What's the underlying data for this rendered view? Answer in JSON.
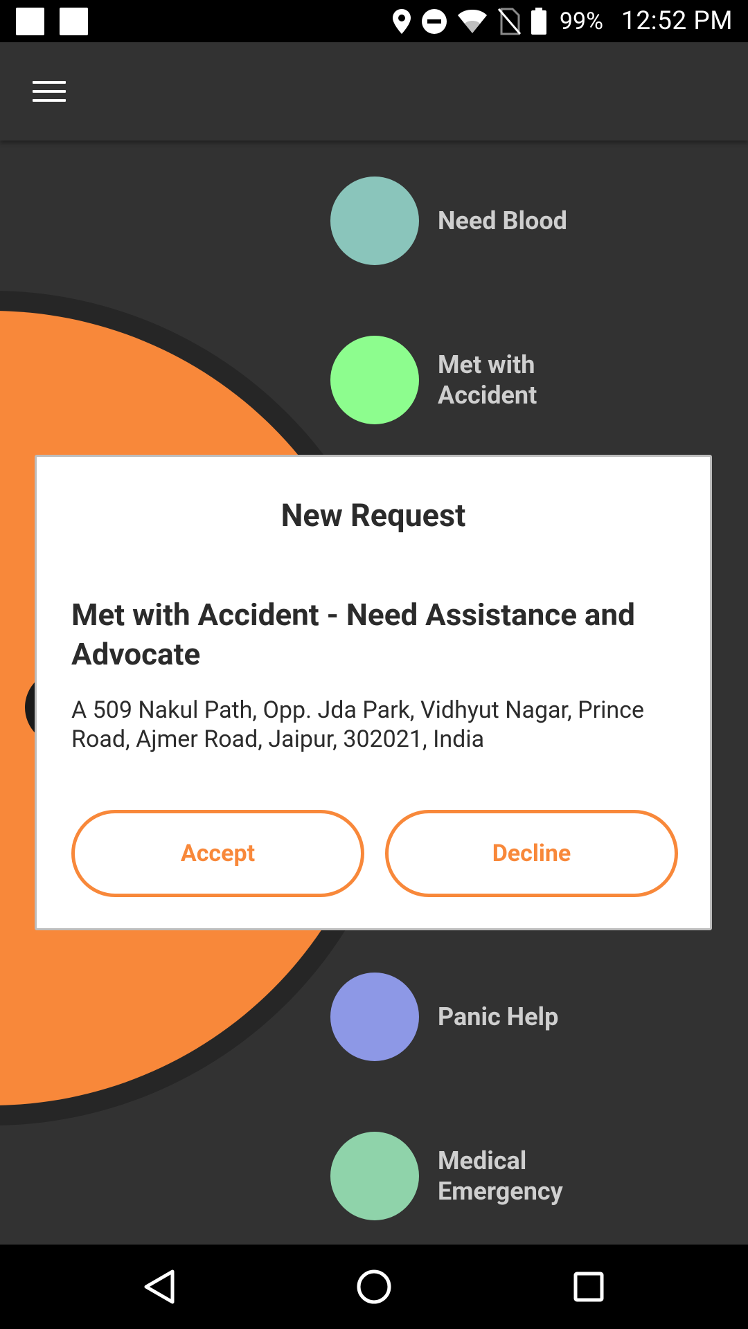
{
  "status_bar": {
    "battery": "99%",
    "time": "12:52 PM",
    "icons": [
      "notification-square-icon",
      "notification-square-icon",
      "location-pin-icon",
      "do-not-disturb-icon",
      "wifi-icon",
      "no-sim-icon",
      "battery-icon"
    ]
  },
  "app_bar": {
    "menu_icon": "hamburger-menu-icon"
  },
  "options": [
    {
      "label": "Need Blood",
      "color": "#8ac5bb"
    },
    {
      "label": "Met with Accident",
      "color": "#8dfd8e"
    },
    {
      "label": "Panic Help",
      "color": "#8d98e6"
    },
    {
      "label": "Medical Emergency",
      "color": "#8fd3aa"
    }
  ],
  "dialog": {
    "title": "New Request",
    "heading": "Met with Accident - Need Assistance and Advocate",
    "address": "A 509 Nakul Path, Opp. Jda Park, Vidhyut Nagar, Prince Road, Ajmer Road, Jaipur, 302021, India",
    "accept_label": "Accept",
    "decline_label": "Decline"
  },
  "nav_bar": {
    "icons": [
      "back-icon",
      "home-icon",
      "recents-icon"
    ]
  },
  "colors": {
    "accent": "#f8883a",
    "background": "#323232",
    "status_bar": "#000000"
  }
}
